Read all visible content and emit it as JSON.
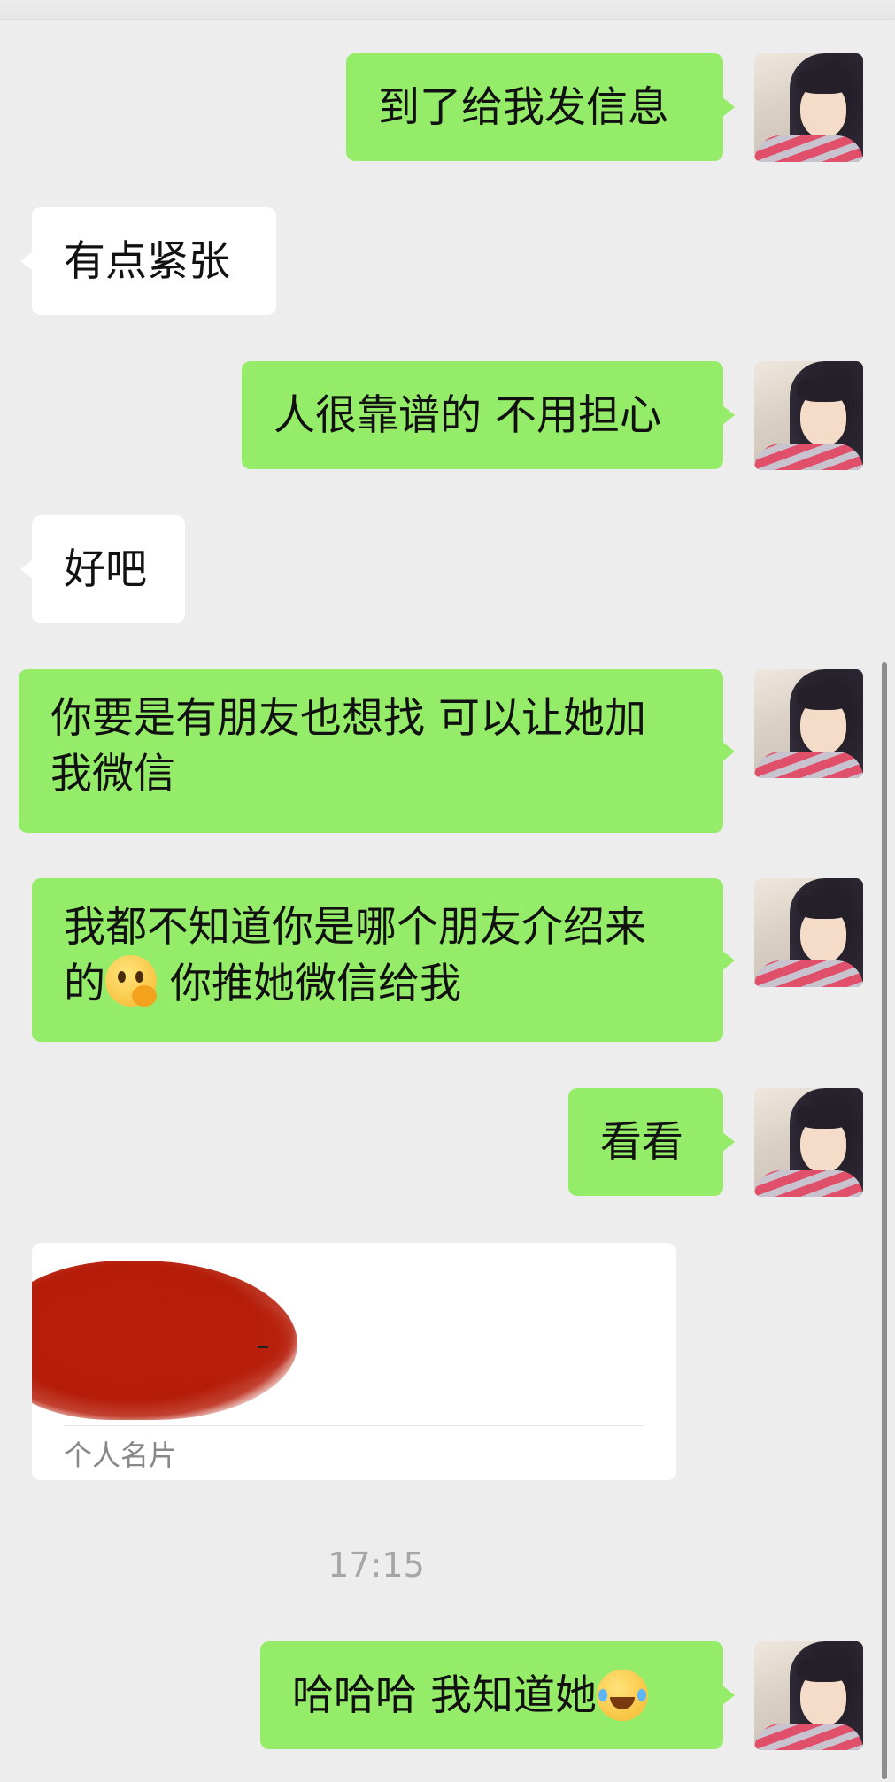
{
  "messages": [
    {
      "from": "me",
      "text": "到了给我发信息"
    },
    {
      "from": "them",
      "text": "有点紧张"
    },
    {
      "from": "me",
      "text": "人很靠谱的 不用担心"
    },
    {
      "from": "them",
      "text": "好吧"
    },
    {
      "from": "me",
      "line1": "你要是有朋友也想找 可以让她加",
      "line2": "我微信"
    },
    {
      "from": "me",
      "line1": "我都不知道你是哪个朋友介绍来",
      "line2_pre": "的",
      "line2_emoji": "thinking-emoji",
      "line2_post": " 你推她微信给我"
    },
    {
      "from": "me",
      "text": "看看"
    },
    {
      "from": "them",
      "type": "contact-card",
      "label": "个人名片"
    },
    {
      "from": "me",
      "text": "哈哈哈 我知道她 ",
      "emoji": "tears-of-joy-emoji"
    }
  ],
  "timestamp": "17:15",
  "colors": {
    "background": "#ededed",
    "my_bubble": "#95ec69",
    "their_bubble": "#ffffff",
    "redaction": "#b71f0b"
  }
}
